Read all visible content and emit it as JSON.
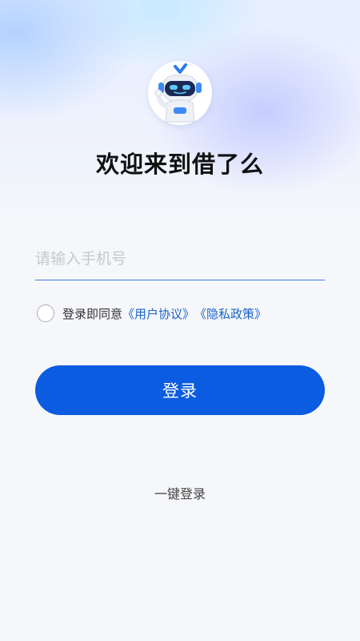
{
  "header": {
    "avatar_icon": "robot-mascot-icon",
    "title": "欢迎来到借了么"
  },
  "login_form": {
    "phone_placeholder": "请输入手机号",
    "phone_value": "",
    "agreement_prefix": "登录即同意",
    "user_agreement_link": "《用户协议》",
    "privacy_policy_link": "《隐私政策》",
    "agreement_checked": false,
    "login_button_label": "登录",
    "one_click_login_label": "一键登录"
  },
  "colors": {
    "accent": "#0b5ce0",
    "link": "#1a63c9",
    "background": "#f6f7fa"
  }
}
